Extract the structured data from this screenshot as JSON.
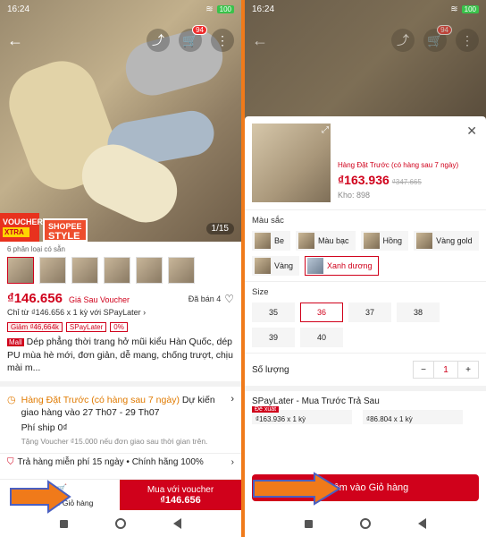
{
  "status": {
    "time": "16:24",
    "battery": "100"
  },
  "left": {
    "cart_count": "94",
    "badge_voucher_top": "VOUCHER",
    "badge_voucher_bottom": "XTRA",
    "badge_shopee_top": "SHOPEE",
    "badge_shopee_bottom": "STYLE",
    "image_counter": "1/15",
    "variants_note": "6 phân loại có sẵn",
    "price": "₫146.656",
    "voucher_label": "Giá Sau Voucher",
    "sold": "Đã bán 4",
    "spaylater_line": "Chỉ từ ₫146.656 x 1 kỳ với SPayLater",
    "tag_discount": "Giảm ₫46,664k",
    "tag_spay": "SPayLater",
    "tag_zero": "0%",
    "mall_tag": "Mall",
    "title": "Dép phẳng thời trang hở mũi kiểu Hàn Quốc, dép PU mùa hè mới, đơn giản, dễ mang, chống trượt, chịu mài m...",
    "ship_preorder": "Hàng Đặt Trước (có hàng sau 7 ngày)",
    "ship_estimate": " Dự kiến giao hàng vào 27 Th07 - 29 Th07",
    "ship_fee": "Phí ship 0₫",
    "ship_note": "Tặng Voucher ₫15.000 nếu đơn giao sau thời gian trên.",
    "return_text": "Trả hàng miễn phí 15 ngày  •  Chính hãng 100%",
    "add_cart": "Thêm vào Giỏ hàng",
    "buy_label": "Mua với voucher",
    "buy_price": "₫146.656"
  },
  "right": {
    "preorder": "Hàng Đặt Trước (có hàng sau 7 ngày)",
    "price": "₫163.936",
    "old_price": "₫347.665",
    "stock": "Kho: 898",
    "color_label": "Màu sắc",
    "colors": [
      "Be",
      "Màu bạc",
      "Hồng",
      "Vàng gold",
      "Vàng",
      "Xanh dương"
    ],
    "size_label": "Size",
    "sizes": [
      "35",
      "36",
      "37",
      "38",
      "39",
      "40"
    ],
    "qty_label": "Số lượng",
    "qty_value": "1",
    "spaylater_title": "SPayLater - Mua Trước Trả Sau",
    "recommended": "Đề xuất",
    "plan1": "₫163.936 x 1 kỳ",
    "plan2": "₫86.804 x 1 kỳ",
    "add_button": "Thêm vào Giỏ hàng"
  }
}
